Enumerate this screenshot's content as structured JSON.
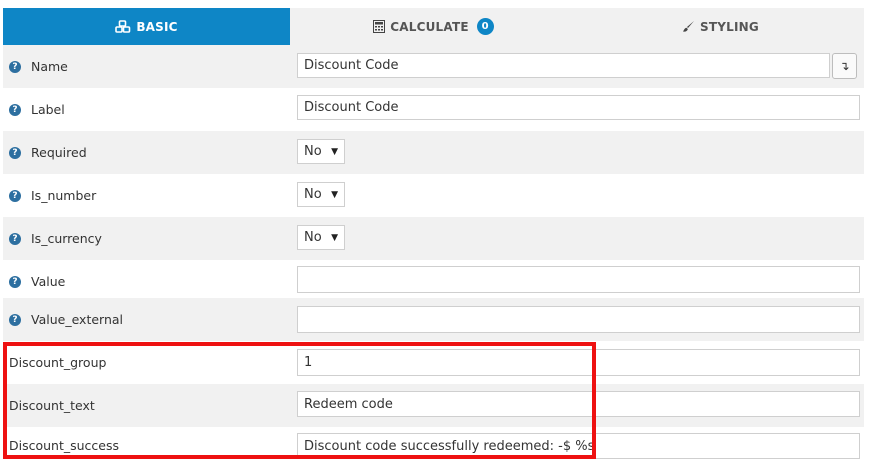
{
  "tabs": [
    {
      "label": "BASIC",
      "icon": "cubes-icon"
    },
    {
      "label": "CALCULATE",
      "icon": "calculator-icon",
      "badge": "0"
    },
    {
      "label": "STYLING",
      "icon": "brush-icon"
    }
  ],
  "fields": {
    "name": {
      "label": "Name",
      "value": "Discount Code"
    },
    "label": {
      "label": "Label",
      "value": "Discount Code"
    },
    "required": {
      "label": "Required",
      "value": "No"
    },
    "is_number": {
      "label": "Is_number",
      "value": "No"
    },
    "is_currency": {
      "label": "Is_currency",
      "value": "No"
    },
    "value": {
      "label": "Value",
      "value": ""
    },
    "value_external": {
      "label": "Value_external",
      "value": ""
    },
    "discount_group": {
      "label": "Discount_group",
      "value": "1"
    },
    "discount_text": {
      "label": "Discount_text",
      "value": "Redeem code"
    },
    "discount_success": {
      "label": "Discount_success",
      "value": "Discount code successfully redeemed: -$ %s"
    }
  },
  "colors": {
    "accent": "#0e86c6",
    "highlight": "#ee1111",
    "help_icon": "#2d6fa0"
  }
}
